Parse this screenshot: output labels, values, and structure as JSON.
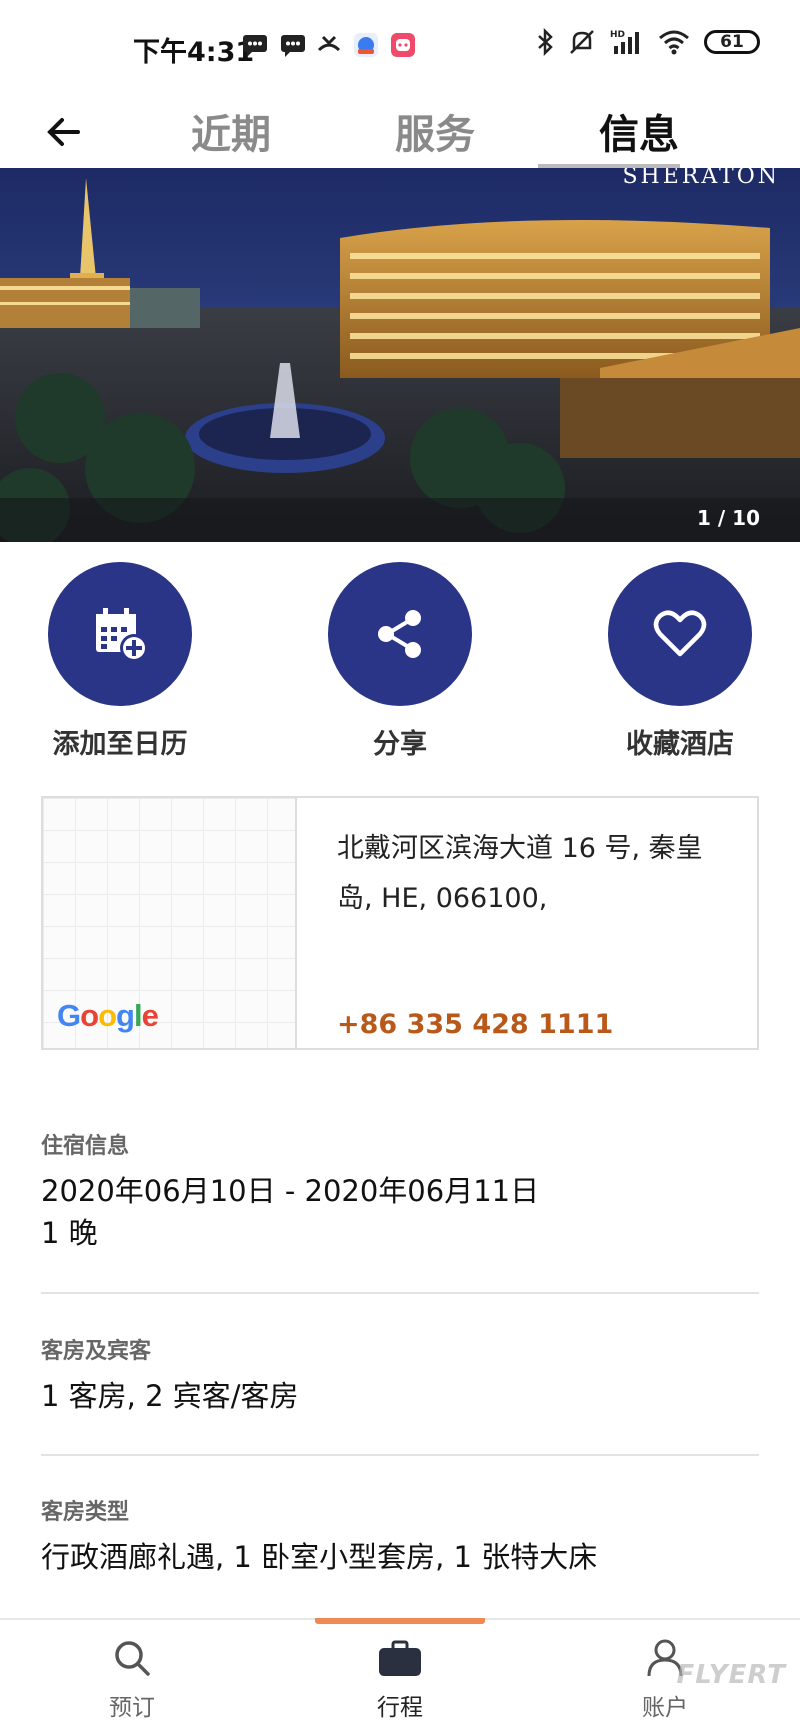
{
  "status_bar": {
    "time": "下午4:31",
    "battery": "61"
  },
  "header": {
    "tabs": [
      {
        "label": "近期",
        "active": false
      },
      {
        "label": "服务",
        "active": false
      },
      {
        "label": "信息",
        "active": true
      }
    ]
  },
  "hero": {
    "brand": "SHERATON",
    "counter": "1 / 10"
  },
  "actions": {
    "calendar_label": "添加至日历",
    "share_label": "分享",
    "favorite_label": "收藏酒店"
  },
  "location": {
    "map_logo": "Google",
    "address": "北戴河区滨海大道 16 号, 秦皇岛, HE, 066100,",
    "phone": "+86 335 428 1111"
  },
  "stay": {
    "title": "住宿信息",
    "dates": "2020年06月10日 - 2020年06月11日",
    "nights": "1 晚"
  },
  "rooms": {
    "title": "客房及宾客",
    "value": "1 客房, 2 宾客/客房"
  },
  "room_type": {
    "title": "客房类型",
    "value": "行政酒廊礼遇, 1 卧室小型套房, 1  张特大床"
  },
  "bottom_nav": {
    "book_label": "预订",
    "trips_label": "行程",
    "account_label": "账户",
    "watermark": "FLYERT"
  },
  "colors": {
    "accent_blue": "#2a3588",
    "phone_orange": "#b8591a",
    "nav_indicator": "#f08a55"
  }
}
